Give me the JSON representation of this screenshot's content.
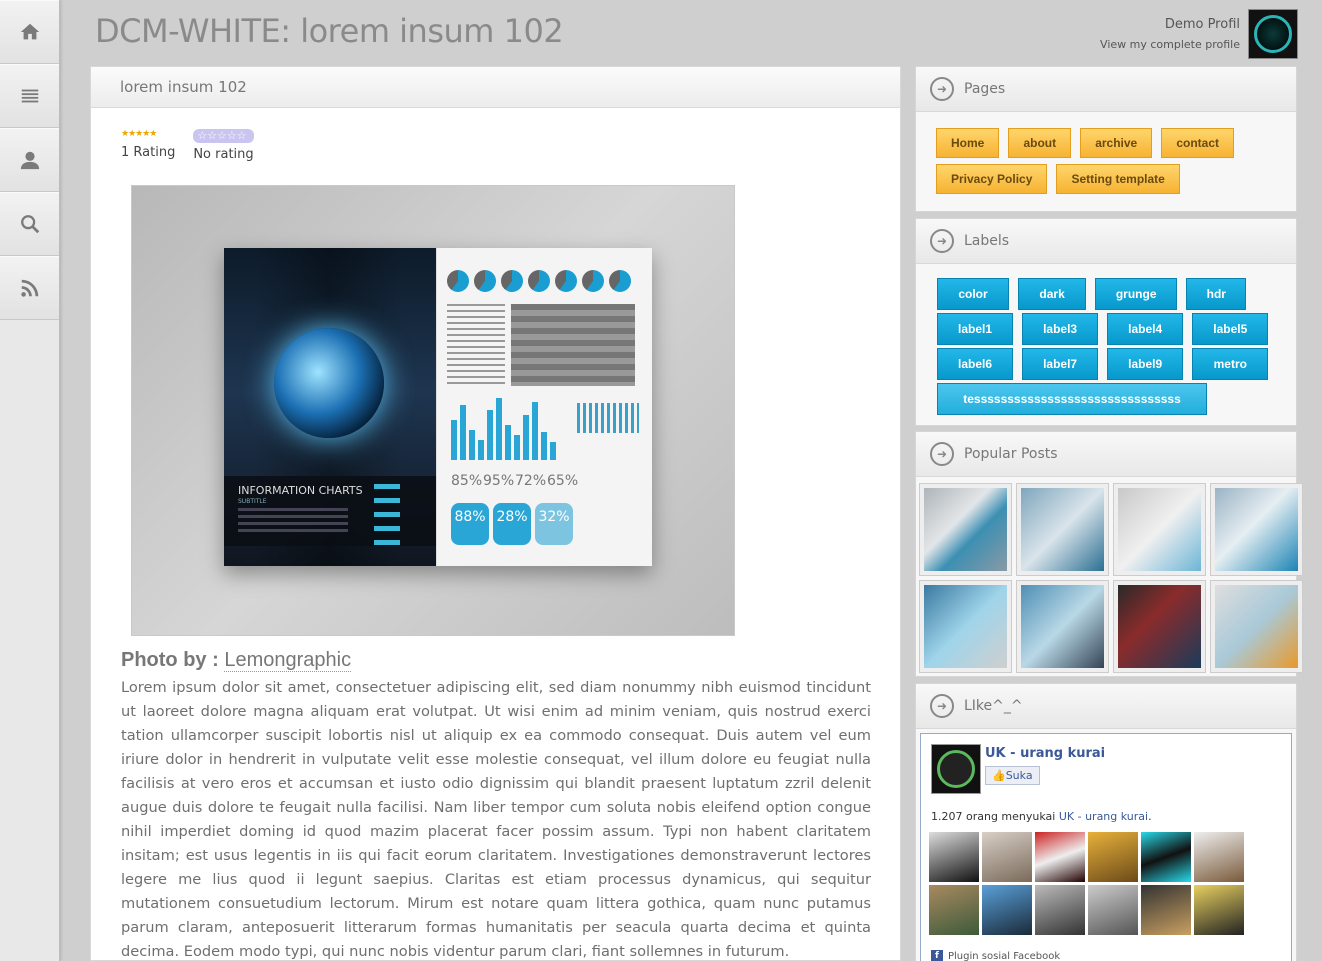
{
  "header": {
    "site_title": "DCM-WHITE: lorem insum 102",
    "profile_name": "Demo Profil",
    "profile_link": "View my complete profile"
  },
  "nav": {
    "icons": [
      "home-icon",
      "list-icon",
      "user-icon",
      "search-icon",
      "rss-icon"
    ]
  },
  "post": {
    "title": "lorem insum 102",
    "rating_count": "1 Rating",
    "rating_none": "No rating",
    "photo_by_label": "Photo by :",
    "photo_by_link": "Lemongraphic",
    "image": {
      "cover_title": "INFORMATION CHARTS",
      "cover_subtitle": "SUBTITLE",
      "percent_1": "85%",
      "percent_2": "95%",
      "percent_3": "72%",
      "percent_4": "65%",
      "pill_1": "88%",
      "pill_2": "28%",
      "pill_3": "32%"
    },
    "body": "Lorem ipsum dolor sit amet, consectetuer adipiscing elit, sed diam nonummy nibh euismod tincidunt ut laoreet dolore magna aliquam erat volutpat. Ut wisi enim ad minim veniam, quis nostrud exerci tation ullamcorper suscipit lobortis nisl ut aliquip ex ea commodo consequat. Duis autem vel eum iriure dolor in hendrerit in vulputate velit esse molestie consequat, vel illum dolore eu feugiat nulla facilisis at vero eros et accumsan et iusto odio dignissim qui blandit praesent luptatum zzril delenit augue duis dolore te feugait nulla facilisi. Nam liber tempor cum soluta nobis eleifend option congue nihil imperdiet doming id quod mazim placerat facer possim assum. Typi non habent claritatem insitam; est usus legentis in iis qui facit eorum claritatem. Investigationes demonstraverunt lectores legere me lius quod ii legunt saepius. Claritas est etiam processus dynamicus, qui sequitur mutationem consuetudium lectorum. Mirum est notare quam littera gothica, quam nunc putamus parum claram, anteposuerit litterarum formas humanitatis per seacula quarta decima et quinta decima. Eodem modo typi, qui nunc nobis videntur parum clari, fiant sollemnes in futurum."
  },
  "sidebar": {
    "pages": {
      "title": "Pages",
      "items": [
        "Home",
        "about",
        "archive",
        "contact",
        "Privacy Policy",
        "Setting template"
      ]
    },
    "labels": {
      "title": "Labels",
      "items": [
        "color",
        "dark",
        "grunge",
        "hdr",
        "label1",
        "label3",
        "label4",
        "label5",
        "label6",
        "label7",
        "label9",
        "metro",
        "tesssssssssssssssssssssssssssssss"
      ]
    },
    "popular": {
      "title": "Popular Posts"
    },
    "like": {
      "title": "LIke^_^",
      "page_name": "UK - urang kurai",
      "like_button": "Suka",
      "count_text": "1.207 orang menyukai ",
      "count_link": "UK - urang kurai",
      "count_end": ".",
      "footer": "Plugin sosial Facebook"
    }
  },
  "colors": {
    "accent_orange": "#f6b333",
    "accent_blue": "#0898cc",
    "facebook": "#3b5998"
  }
}
